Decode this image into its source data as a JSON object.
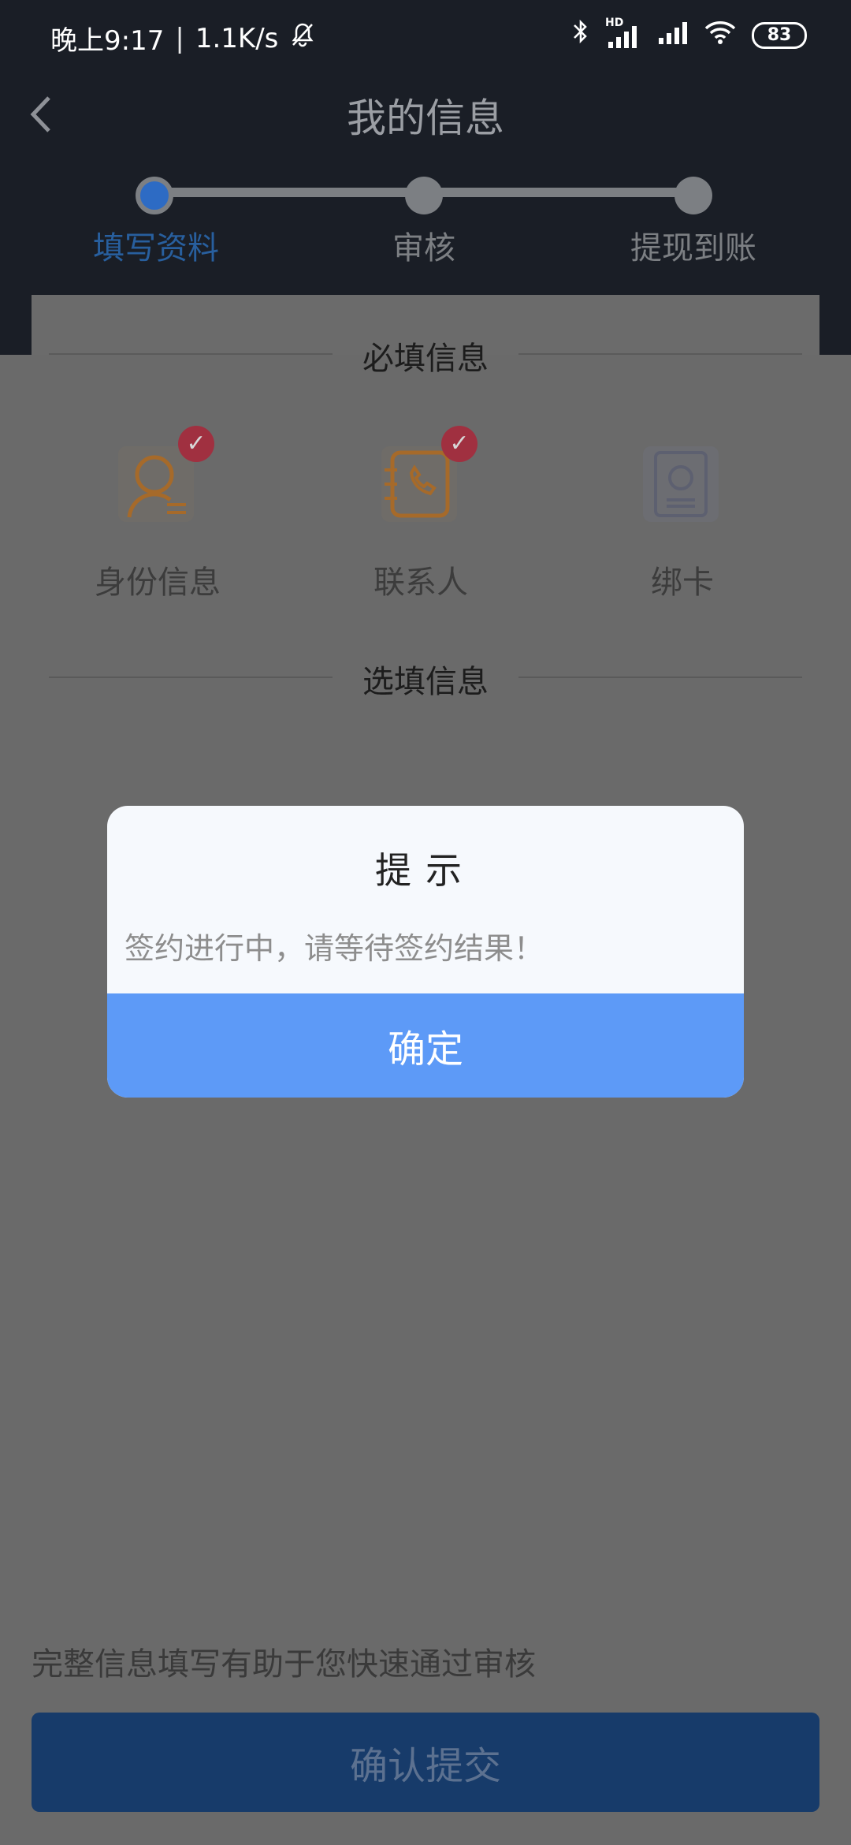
{
  "status_bar": {
    "time": "晚上9:17",
    "speed": "1.1K/s",
    "hd": "HD",
    "battery": "83"
  },
  "header": {
    "title": "我的信息",
    "steps": [
      {
        "label": "填写资料",
        "active": true
      },
      {
        "label": "审核",
        "active": false
      },
      {
        "label": "提现到账",
        "active": false
      }
    ]
  },
  "sections": {
    "required_title": "必填信息",
    "optional_title": "选填信息",
    "required_items": [
      {
        "label": "身份信息",
        "icon": "id-card-icon",
        "done": true
      },
      {
        "label": "联系人",
        "icon": "contact-phone-icon",
        "done": true
      },
      {
        "label": "绑卡",
        "icon": "bank-card-icon",
        "done": false
      }
    ]
  },
  "footer": {
    "hint": "完整信息填写有助于您快速通过审核",
    "submit_label": "确认提交"
  },
  "dialog": {
    "title": "提示",
    "message": "签约进行中，请等待签约结果！",
    "confirm_label": "确定"
  },
  "colors": {
    "header_bg": "#1a1e26",
    "overlay_bg": "#6a6a6a",
    "dialog_button": "#5d9af7",
    "step_active": "#285f9e"
  }
}
